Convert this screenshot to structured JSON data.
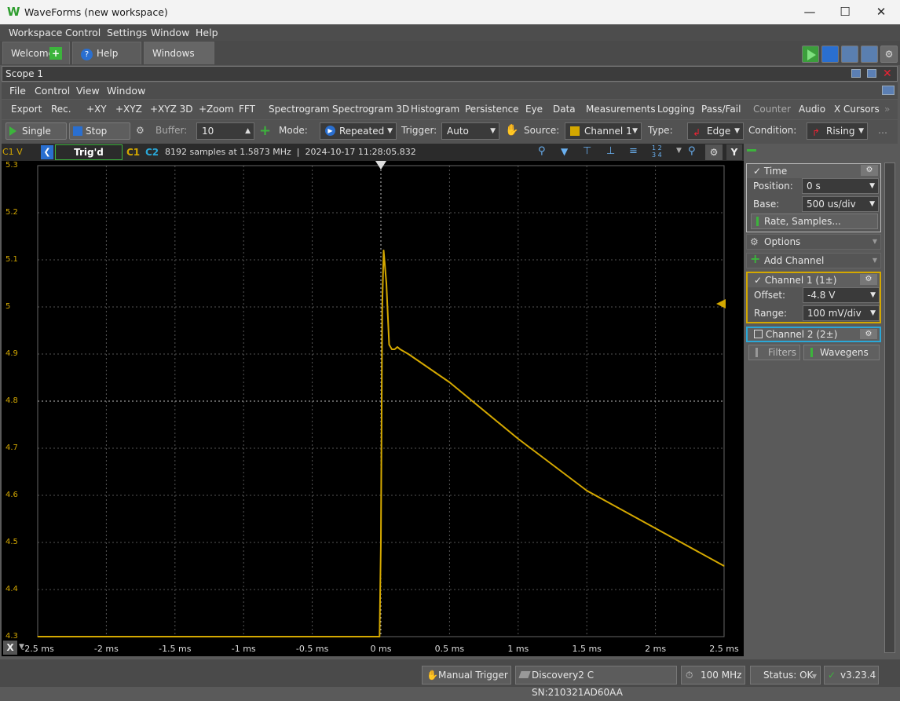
{
  "window": {
    "title": "WaveForms (new workspace)",
    "logo": "W"
  },
  "menu": [
    "Workspace",
    "Control",
    "Settings",
    "Window",
    "Help"
  ],
  "tabs": {
    "welcome": "Welcome",
    "help": "Help",
    "windows": "Windows"
  },
  "scope": {
    "title": "Scope 1",
    "menu": [
      "File",
      "Control",
      "View",
      "Window"
    ],
    "toolbar": [
      "Export",
      "Rec.",
      "+XY",
      "+XYZ",
      "+XYZ 3D",
      "+Zoom",
      "FFT",
      "Spectrogram",
      "Spectrogram 3D",
      "Histogram",
      "Persistence",
      "Eye",
      "Data",
      "Measurements",
      "Logging",
      "Pass/Fail",
      "Counter",
      "Audio",
      "X Cursors"
    ],
    "controls": {
      "single": "Single",
      "stop": "Stop",
      "buffer_label": "Buffer:",
      "buffer_value": "10",
      "mode_label": "Mode:",
      "mode_value": "Repeated",
      "trigger_label": "Trigger:",
      "trigger_value": "Auto",
      "source_label": "Source:",
      "source_value": "Channel 1",
      "type_label": "Type:",
      "type_value": "Edge",
      "condition_label": "Condition:",
      "condition_value": "Rising"
    },
    "plot_header": {
      "ylabel": "C1 V",
      "status": "Trig'd",
      "c1": "C1",
      "c2": "C2",
      "info": "8192 samples at 1.5873 MHz  |  2024-10-17 11:28:05.832",
      "y_button": "Y"
    },
    "x_button": "X"
  },
  "colors": {
    "channel1": "#d4a800",
    "channel2": "#2aa8d8",
    "accent_green": "#3cb43c"
  },
  "right_panel": {
    "time": {
      "title": "Time",
      "position_label": "Position:",
      "position_value": "0 s",
      "base_label": "Base:",
      "base_value": "500 us/div",
      "rate_button": "Rate, Samples..."
    },
    "options": "Options",
    "add_channel": "Add Channel",
    "channel1": {
      "title": "Channel 1 (1±)",
      "offset_label": "Offset:",
      "offset_value": "-4.8 V",
      "range_label": "Range:",
      "range_value": "100 mV/div"
    },
    "channel2": {
      "title": "Channel 2 (2±)"
    },
    "filters": "Filters",
    "wavegens": "Wavegens"
  },
  "status_bar": {
    "manual_trigger": "Manual Trigger",
    "device": "Discovery2 C SN:210321AD60AA",
    "clock": "100 MHz",
    "status": "Status: OK",
    "version": "v3.23.4"
  },
  "chart_data": {
    "type": "line",
    "title": "",
    "xlabel": "",
    "ylabel": "C1 V",
    "xlim": [
      -2.5,
      2.5
    ],
    "ylim": [
      4.3,
      5.3
    ],
    "x_ticks": [
      "-2.5 ms",
      "-2 ms",
      "-1.5 ms",
      "-1 ms",
      "-0.5 ms",
      "0 ms",
      "0.5 ms",
      "1 ms",
      "1.5 ms",
      "2 ms",
      "2.5 ms"
    ],
    "y_ticks": [
      "5.3",
      "5.2",
      "5.1",
      "5",
      "4.9",
      "4.8",
      "4.7",
      "4.6",
      "4.5",
      "4.4",
      "4.3"
    ],
    "grid": true,
    "series": [
      {
        "name": "C1",
        "x": [
          -2.5,
          -0.02,
          -0.01,
          0.0,
          0.01,
          0.02,
          0.04,
          0.06,
          0.08,
          0.1,
          0.12,
          0.14,
          0.2,
          0.5,
          1.0,
          1.5,
          2.0,
          2.5
        ],
        "y": [
          4.3,
          4.3,
          4.3,
          4.5,
          5.0,
          5.12,
          5.05,
          4.92,
          4.91,
          4.91,
          4.915,
          4.91,
          4.9,
          4.84,
          4.72,
          4.61,
          4.53,
          4.45
        ]
      }
    ]
  }
}
